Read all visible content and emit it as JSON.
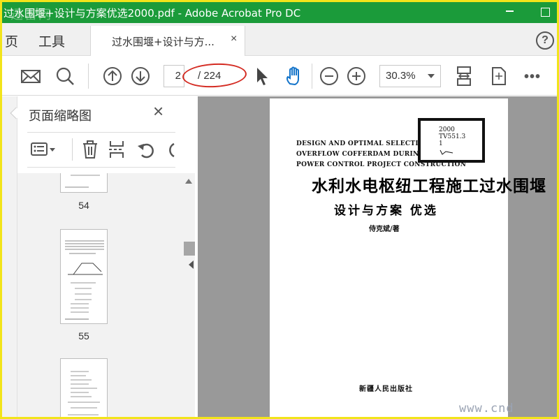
{
  "window": {
    "title": "过水围堰+设计与方案优选2000.pdf - Adobe Acrobat Pro DC",
    "watermark": "迅雷网"
  },
  "menu": {
    "home_label": "页",
    "tools_label": "工具"
  },
  "tab": {
    "label": "过水围堰+设计与方...",
    "close": "×"
  },
  "help": {
    "label": "?"
  },
  "toolbar": {
    "current_page": "2",
    "total_pages": "/ 224",
    "zoom": "30.3%",
    "more": "•••"
  },
  "thumbnails": {
    "title": "页面缩略图",
    "close": "×",
    "pages": [
      {
        "number": "54"
      },
      {
        "number": "55"
      }
    ]
  },
  "document": {
    "english_title": "DESIGN AND OPTIMAL SELECTION O\nOVERFLOW COFFERDAM DURING K\nPOWER CONTROL PROJECT CONSTRUCTION",
    "stamp_lines": [
      "2000",
      "TV551.3",
      "1"
    ],
    "chinese_title": "水利水电枢纽工程施工过水围堰",
    "chinese_subtitle": "设计与方案 优选",
    "author": "侍克斌/著",
    "publisher": "新疆人民出版社"
  },
  "site_watermark": "www.cnd",
  "colors": {
    "titlebar": "#1b9b3a",
    "annotation": "#d42b22",
    "page_border": "#f2e41a",
    "doc_background": "#999999"
  }
}
